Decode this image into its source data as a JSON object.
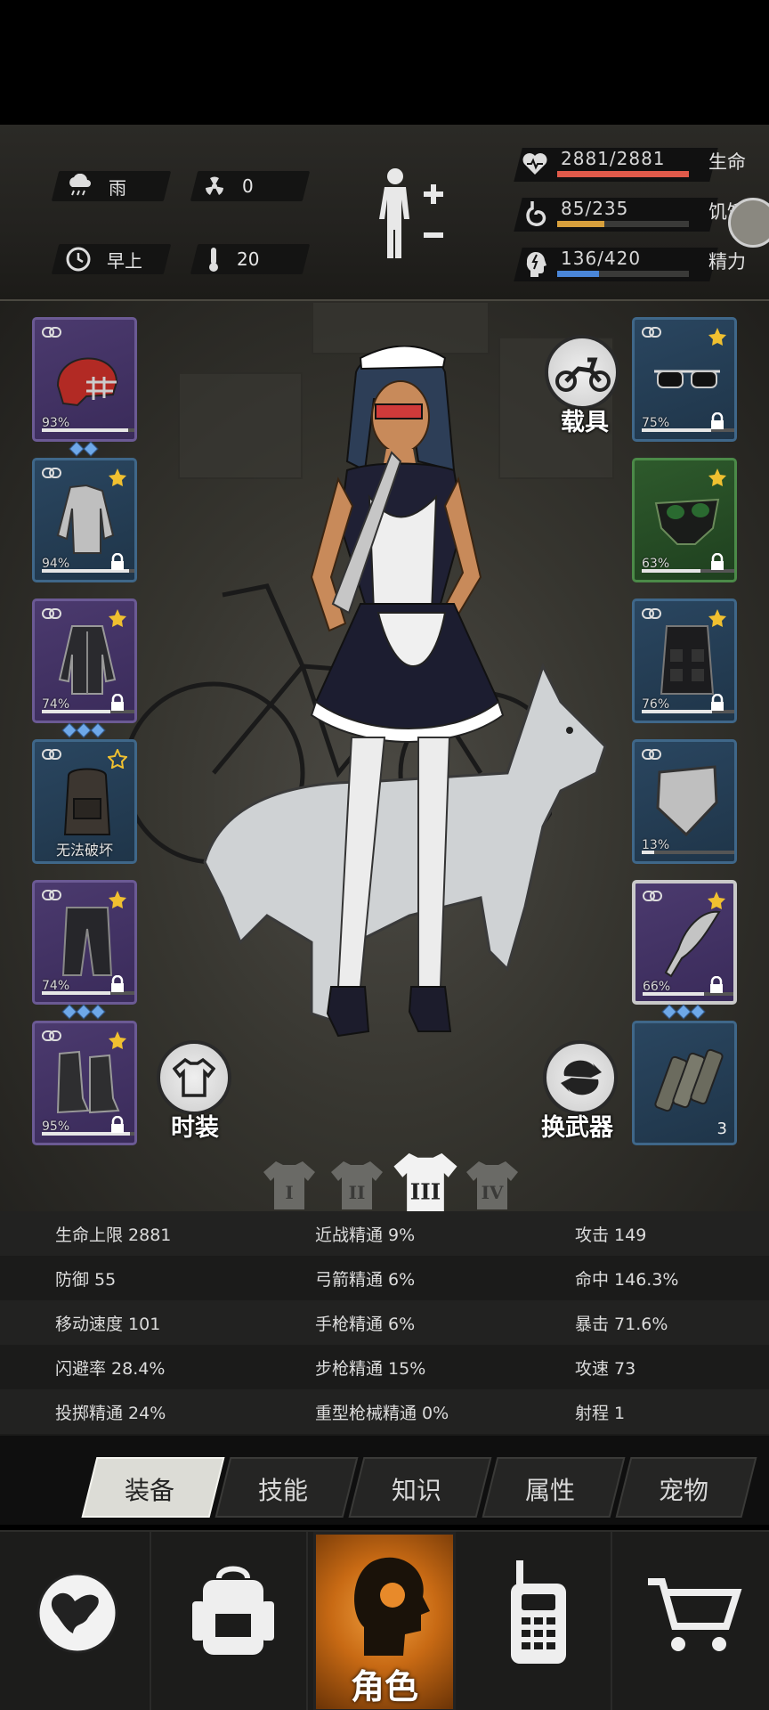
{
  "status": {
    "weather": "雨",
    "radiation": "0",
    "time_of_day": "早上",
    "temperature": "20",
    "health_text": "2881/2881",
    "health_label": "生命",
    "health_ratio": 1.0,
    "hunger_text": "85/235",
    "hunger_label": "饥饿",
    "hunger_ratio": 0.36,
    "energy_text": "136/420",
    "energy_label": "精力",
    "energy_ratio": 0.32,
    "colors": {
      "health": "#e05a4a",
      "hunger": "#d8a03c",
      "energy": "#4a86d8"
    }
  },
  "equipment_left": [
    {
      "name": "helmet",
      "durability": "93%",
      "dur_value": 0.93,
      "diamonds": 2,
      "rarity": "purple"
    },
    {
      "name": "shirt",
      "durability": "94%",
      "dur_value": 0.94,
      "star": true,
      "rarity": "blue"
    },
    {
      "name": "jacket",
      "durability": "74%",
      "dur_value": 0.74,
      "star": true,
      "diamonds": 3,
      "rarity": "purple"
    },
    {
      "name": "backpack",
      "unbreakable": "无法破坏",
      "star_outline": true,
      "rarity": "blue"
    },
    {
      "name": "pants",
      "durability": "74%",
      "dur_value": 0.74,
      "star": true,
      "diamonds": 3,
      "rarity": "purple"
    },
    {
      "name": "boots",
      "durability": "95%",
      "dur_value": 0.95,
      "star": true,
      "rarity": "purple"
    }
  ],
  "equipment_right": [
    {
      "name": "sunglasses",
      "durability": "75%",
      "dur_value": 0.75,
      "star": true,
      "rarity": "blue"
    },
    {
      "name": "gas-mask",
      "durability": "63%",
      "dur_value": 0.63,
      "star": true,
      "rarity": "green"
    },
    {
      "name": "tactical-vest",
      "durability": "76%",
      "dur_value": 0.76,
      "star": true,
      "rarity": "blue"
    },
    {
      "name": "shield",
      "durability": "13%",
      "dur_value": 0.13,
      "rarity": "blue"
    },
    {
      "name": "machete",
      "durability": "66%",
      "dur_value": 0.66,
      "star": true,
      "diamonds": 3,
      "rarity": "purple"
    },
    {
      "name": "dynamite",
      "count": "3",
      "rarity": "blue"
    }
  ],
  "buttons": {
    "vehicle": "载具",
    "fashion": "时装",
    "switch_weapon": "换武器"
  },
  "outfits": [
    "I",
    "II",
    "III",
    "IV"
  ],
  "outfit_selected": 2,
  "stats": [
    [
      "生命上限 2881",
      "近战精通 9%",
      "攻击 149"
    ],
    [
      "防御 55",
      "弓箭精通 6%",
      "命中 146.3%"
    ],
    [
      "移动速度 101",
      "手枪精通 6%",
      "暴击 71.6%"
    ],
    [
      "闪避率 28.4%",
      "步枪精通 15%",
      "攻速 73"
    ],
    [
      "投掷精通 24%",
      "重型枪械精通 0%",
      "射程 1"
    ]
  ],
  "tabs": [
    "装备",
    "技能",
    "知识",
    "属性",
    "宠物"
  ],
  "nav": {
    "character": "角色"
  }
}
